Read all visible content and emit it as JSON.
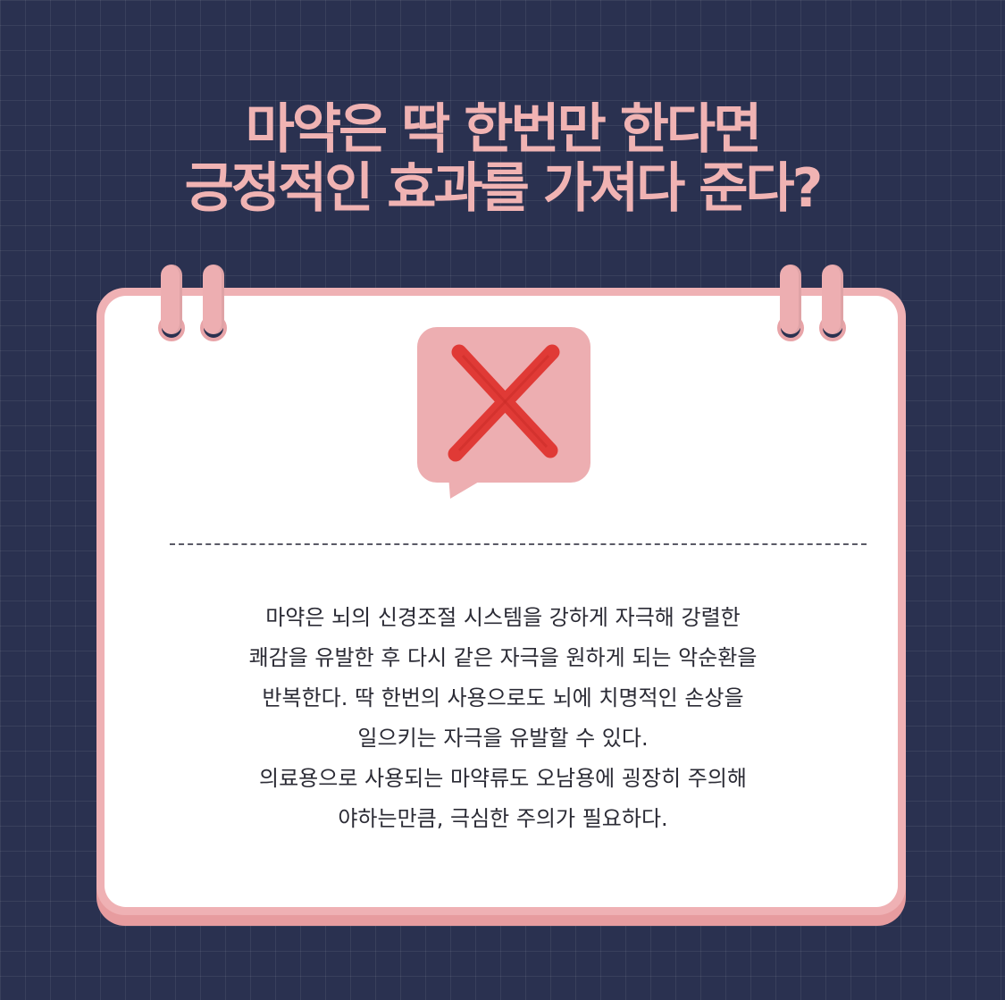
{
  "headline": {
    "line1": "마약은 딱 한번만 한다면",
    "line2": "긍정적인 효과를 가져다 준다?"
  },
  "card": {
    "answer_icon": "red-x-icon",
    "body_lines": [
      "마약은 뇌의 신경조절 시스템을 강하게 자극해 강렬한",
      "쾌감을 유발한 후 다시 같은 자극을 원하게 되는 악순환을",
      "반복한다. 딱 한번의 사용으로도 뇌에 치명적인 손상을",
      "일으키는 자극을 유발할 수 있다.",
      "의료용으로 사용되는 마약류도 오남용에 굉장히 주의해",
      "야하는만큼, 극심한 주의가 필요하다."
    ]
  },
  "colors": {
    "background": "#2a3150",
    "accent_pink": "#efb1b4",
    "headline": "#f0b3b3",
    "x_red": "#e03a36"
  }
}
